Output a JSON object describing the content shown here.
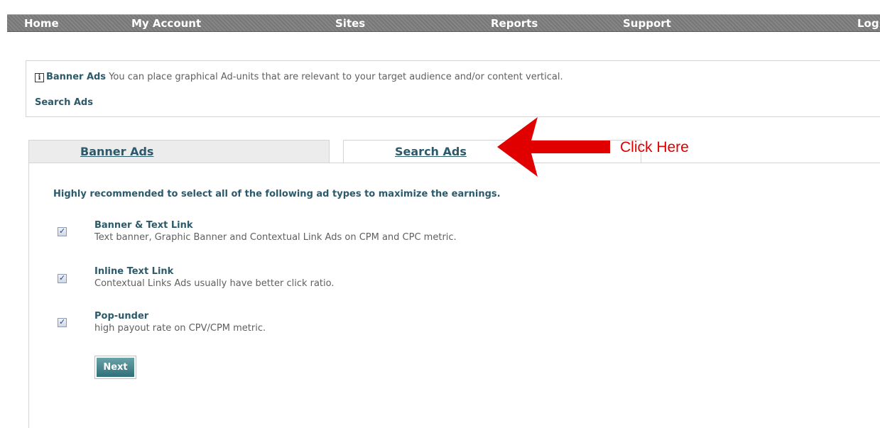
{
  "nav": {
    "items": [
      {
        "label": "Home"
      },
      {
        "label": "My Account"
      },
      {
        "label": "Sites"
      },
      {
        "label": "Reports"
      },
      {
        "label": "Support"
      },
      {
        "label": "Log"
      }
    ]
  },
  "info": {
    "icon": "info-icon",
    "icon_glyph": "i",
    "title": "Banner Ads",
    "text": " You can place graphical Ad-units that are relevant to your target audience and/or content vertical.",
    "search_link": "Search Ads"
  },
  "tabs": [
    {
      "label": "Banner Ads",
      "active": false
    },
    {
      "label": "Search Ads",
      "active": true
    }
  ],
  "content": {
    "recommend": "Highly recommended to select all of the following ad types to maximize the earnings.",
    "options": [
      {
        "title": "Banner & Text Link",
        "desc": "Text banner, Graphic Banner and Contextual Link Ads on CPM and CPC metric.",
        "checked": true
      },
      {
        "title": "Inline Text Link",
        "desc": "Contextual Links Ads usually have better click ratio.",
        "checked": true
      },
      {
        "title": "Pop-under",
        "desc": "high payout rate on CPV/CPM metric.",
        "checked": true
      }
    ],
    "next_label": "Next"
  },
  "annotation": {
    "text": "Click Here",
    "color": "#e00000"
  },
  "colors": {
    "accent": "#2c5a6a",
    "nav_bg": "#7d7d7d"
  }
}
